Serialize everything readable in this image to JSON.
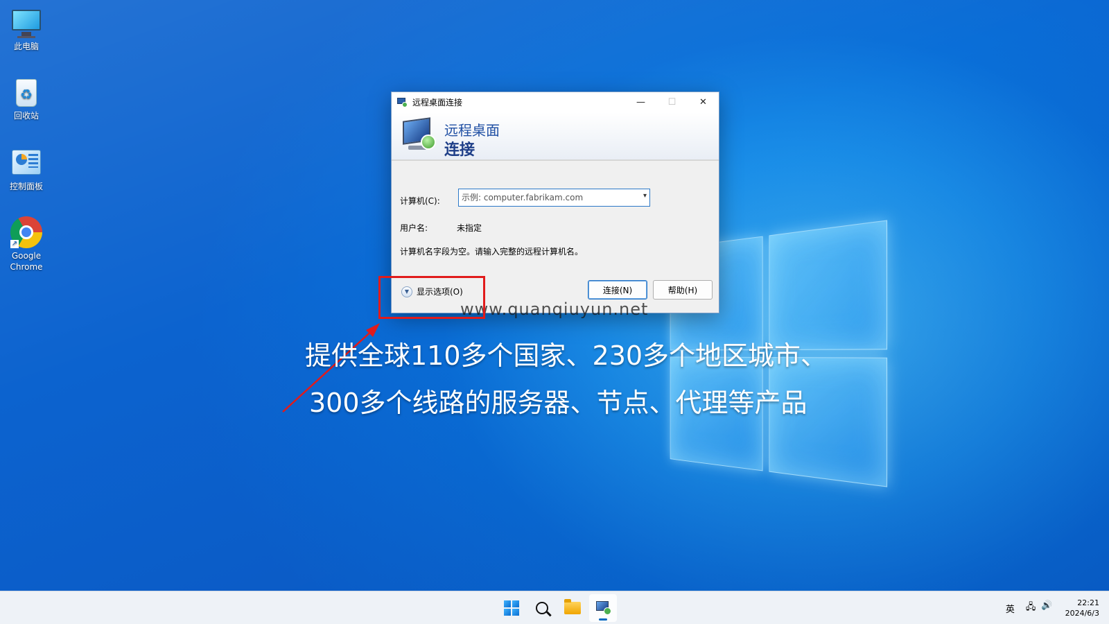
{
  "desktop": {
    "icons": [
      {
        "label": "此电脑"
      },
      {
        "label": "回收站"
      },
      {
        "label": "控制面板"
      },
      {
        "label": "Google Chrome"
      }
    ]
  },
  "dialog": {
    "title": "远程桌面连接",
    "banner_line1": "远程桌面",
    "banner_line2": "连接",
    "computer_label": "计算机(C):",
    "computer_placeholder": "示例: computer.fabrikam.com",
    "computer_value": "",
    "username_label": "用户名:",
    "username_value": "未指定",
    "message": "计算机名字段为空。请输入完整的远程计算机名。",
    "show_options": "显示选项(O)",
    "connect_button": "连接(N)",
    "help_button": "帮助(H)",
    "window_buttons": {
      "minimize": "—",
      "maximize": "☐",
      "close": "✕"
    }
  },
  "overlay": {
    "watermark": "www.quanqiuyun.net",
    "promo_line1": "提供全球110多个国家、230多个地区城市、",
    "promo_line2": "300多个线路的服务器、节点、代理等产品",
    "highlight_color": "#e11b1b"
  },
  "taskbar": {
    "apps": [
      "start-icon",
      "search-icon",
      "file-explorer-icon",
      "remote-desktop-icon"
    ],
    "ime": "英",
    "time": "22:21",
    "date": "2024/6/3"
  }
}
